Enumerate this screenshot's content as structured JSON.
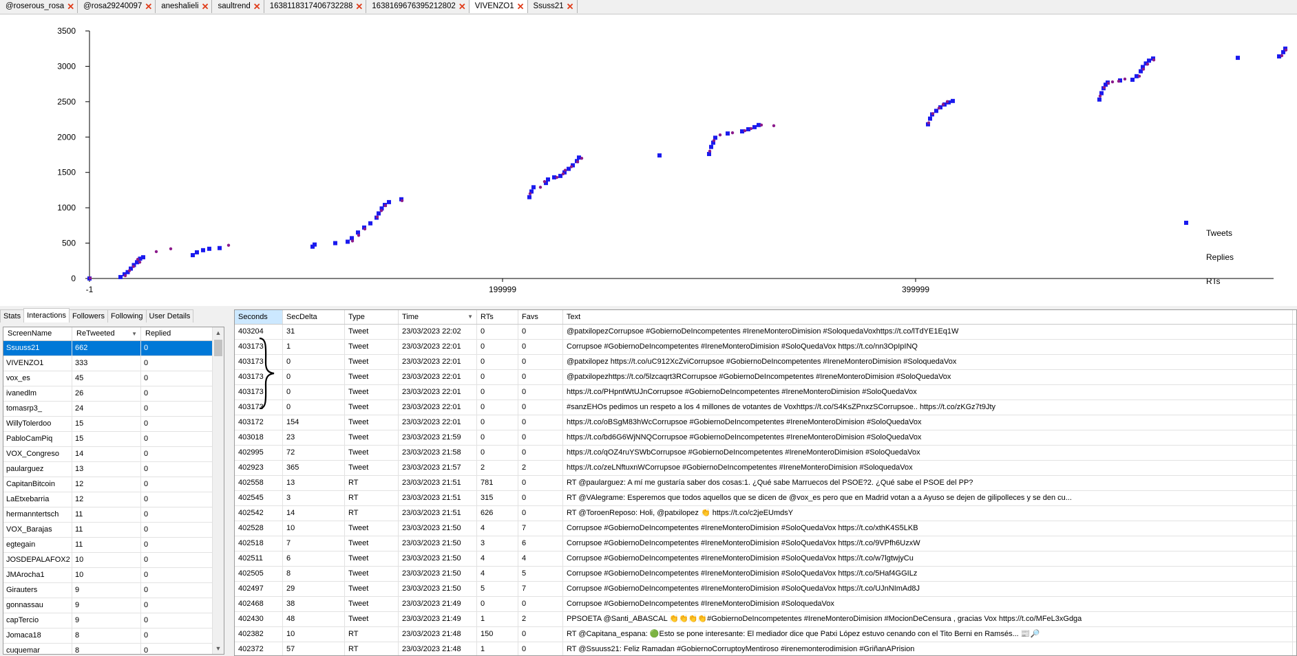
{
  "tabs": [
    {
      "label": "@roserous_rosa",
      "active": false
    },
    {
      "label": "@rosa29240097",
      "active": false
    },
    {
      "label": "aneshalieli",
      "active": false
    },
    {
      "label": "saultrend",
      "active": false
    },
    {
      "label": "1638118317406732288",
      "active": false
    },
    {
      "label": "1638169676395212802",
      "active": false
    },
    {
      "label": "VIVENZO1",
      "active": true
    },
    {
      "label": "Ssuss21",
      "active": false
    }
  ],
  "tab_close_icon": "close-x-icon",
  "colors": {
    "tweets": "#8b1a8b",
    "replies": "#e01010",
    "rts": "#1a1aee",
    "selection": "#0078d7",
    "tab_close": "#e03c1a"
  },
  "chart_data": {
    "type": "scatter",
    "x_ticks": [
      "-1",
      "199999",
      "399999"
    ],
    "y_ticks": [
      "0",
      "500",
      "1000",
      "1500",
      "2000",
      "2500",
      "3000",
      "3500"
    ],
    "xlim": [
      -1,
      580000
    ],
    "ylim": [
      0,
      3500
    ],
    "legend_position": "right",
    "legend": [
      "Tweets",
      "Replies",
      "RTs"
    ],
    "series": [
      {
        "name": "Tweets",
        "marker": "dot",
        "points": [
          [
            0,
            5
          ],
          [
            17000,
            40
          ],
          [
            19000,
            110
          ],
          [
            21000,
            170
          ],
          [
            24000,
            230
          ],
          [
            23000,
            270
          ],
          [
            32000,
            380
          ],
          [
            39000,
            420
          ],
          [
            67000,
            470
          ],
          [
            127000,
            530
          ],
          [
            130000,
            610
          ],
          [
            133000,
            700
          ],
          [
            139000,
            870
          ],
          [
            141000,
            960
          ],
          [
            143000,
            1030
          ],
          [
            151000,
            1100
          ],
          [
            213000,
            1200
          ],
          [
            218000,
            1290
          ],
          [
            220000,
            1370
          ],
          [
            226000,
            1430
          ],
          [
            229000,
            1480
          ],
          [
            230000,
            1530
          ],
          [
            233000,
            1580
          ],
          [
            236000,
            1650
          ],
          [
            238000,
            1700
          ],
          [
            300000,
            1800
          ],
          [
            302000,
            1950
          ],
          [
            305000,
            2030
          ],
          [
            311000,
            2060
          ],
          [
            317000,
            2090
          ],
          [
            320000,
            2120
          ],
          [
            325000,
            2170
          ],
          [
            331000,
            2160
          ],
          [
            406000,
            2200
          ],
          [
            408000,
            2330
          ],
          [
            411000,
            2410
          ],
          [
            413000,
            2460
          ],
          [
            415000,
            2500
          ],
          [
            489000,
            2580
          ],
          [
            491000,
            2700
          ],
          [
            493000,
            2760
          ],
          [
            495000,
            2780
          ],
          [
            498000,
            2790
          ],
          [
            501000,
            2820
          ],
          [
            508000,
            2860
          ],
          [
            510000,
            2960
          ],
          [
            512000,
            3030
          ],
          [
            515000,
            3090
          ],
          [
            577000,
            3150
          ],
          [
            579000,
            3230
          ]
        ]
      },
      {
        "name": "Replies",
        "marker": "dot",
        "points": []
      },
      {
        "name": "RTs",
        "marker": "square",
        "points": [
          [
            0,
            0
          ],
          [
            15000,
            20
          ],
          [
            17000,
            60
          ],
          [
            18500,
            90
          ],
          [
            20000,
            140
          ],
          [
            21500,
            190
          ],
          [
            23000,
            230
          ],
          [
            24500,
            280
          ],
          [
            26000,
            300
          ],
          [
            50000,
            330
          ],
          [
            52000,
            370
          ],
          [
            55000,
            400
          ],
          [
            58000,
            420
          ],
          [
            63000,
            430
          ],
          [
            108000,
            450
          ],
          [
            109000,
            480
          ],
          [
            119000,
            500
          ],
          [
            125000,
            520
          ],
          [
            127000,
            570
          ],
          [
            130000,
            650
          ],
          [
            133000,
            720
          ],
          [
            136000,
            780
          ],
          [
            139000,
            860
          ],
          [
            140000,
            920
          ],
          [
            141500,
            990
          ],
          [
            143000,
            1040
          ],
          [
            145000,
            1080
          ],
          [
            151000,
            1120
          ],
          [
            213000,
            1150
          ],
          [
            214000,
            1230
          ],
          [
            215000,
            1290
          ],
          [
            221000,
            1350
          ],
          [
            222000,
            1400
          ],
          [
            225000,
            1430
          ],
          [
            228000,
            1450
          ],
          [
            230000,
            1500
          ],
          [
            232000,
            1550
          ],
          [
            234000,
            1600
          ],
          [
            236000,
            1660
          ],
          [
            237000,
            1710
          ],
          [
            276000,
            1740
          ],
          [
            300000,
            1760
          ],
          [
            301000,
            1860
          ],
          [
            302000,
            1920
          ],
          [
            303000,
            1990
          ],
          [
            309000,
            2050
          ],
          [
            316000,
            2080
          ],
          [
            319000,
            2110
          ],
          [
            322000,
            2140
          ],
          [
            324000,
            2170
          ],
          [
            406000,
            2180
          ],
          [
            407000,
            2260
          ],
          [
            408000,
            2320
          ],
          [
            410000,
            2370
          ],
          [
            412000,
            2420
          ],
          [
            414000,
            2460
          ],
          [
            416000,
            2490
          ],
          [
            418000,
            2510
          ],
          [
            489000,
            2530
          ],
          [
            490000,
            2620
          ],
          [
            491000,
            2690
          ],
          [
            492000,
            2740
          ],
          [
            493000,
            2770
          ],
          [
            499000,
            2800
          ],
          [
            505000,
            2810
          ],
          [
            507000,
            2860
          ],
          [
            509000,
            2930
          ],
          [
            510000,
            2990
          ],
          [
            511500,
            3040
          ],
          [
            513000,
            3080
          ],
          [
            515000,
            3110
          ],
          [
            556000,
            3120
          ],
          [
            576000,
            3140
          ],
          [
            578000,
            3200
          ],
          [
            579000,
            3250
          ]
        ]
      }
    ]
  },
  "left_tabs": [
    "Stats",
    "Interactions",
    "Followers",
    "Following",
    "User Details"
  ],
  "left_active_tab": "Interactions",
  "left_grid": {
    "columns": [
      "ScreenName",
      "ReTweeted",
      "Replied"
    ],
    "rows": [
      [
        "Ssuuss21",
        "662",
        "0"
      ],
      [
        "VIVENZO1",
        "333",
        "0"
      ],
      [
        "vox_es",
        "45",
        "0"
      ],
      [
        "ivanedlm",
        "26",
        "0"
      ],
      [
        "tomasrp3_",
        "24",
        "0"
      ],
      [
        "WillyTolerdoo",
        "15",
        "0"
      ],
      [
        "PabloCamPiq",
        "15",
        "0"
      ],
      [
        "VOX_Congreso",
        "14",
        "0"
      ],
      [
        "paularguez",
        "13",
        "0"
      ],
      [
        "CapitanBitcoin",
        "12",
        "0"
      ],
      [
        "LaEtxebarria",
        "12",
        "0"
      ],
      [
        "hermanntertsch",
        "11",
        "0"
      ],
      [
        "VOX_Barajas",
        "11",
        "0"
      ],
      [
        "egtegain",
        "11",
        "0"
      ],
      [
        "JOSDEPALAFOX2",
        "10",
        "0"
      ],
      [
        "JMArocha1",
        "10",
        "0"
      ],
      [
        "Girauters",
        "9",
        "0"
      ],
      [
        "gonnassau",
        "9",
        "0"
      ],
      [
        "capTercio",
        "9",
        "0"
      ],
      [
        "Jomaca18",
        "8",
        "0"
      ],
      [
        "cuquemar",
        "8",
        "0"
      ]
    ]
  },
  "right_grid": {
    "columns": [
      "Seconds",
      "SecDelta",
      "Type",
      "Time",
      "RTs",
      "Favs",
      "Text"
    ],
    "rows": [
      [
        "403204",
        "31",
        "Tweet",
        "23/03/2023 22:02",
        "0",
        "0",
        "@patxilopezCorrupsoe #GobiernoDeIncompetentes #IreneMonteroDimision #SoloquedaVoxhttps://t.co/lTdYE1Eq1W"
      ],
      [
        "403173",
        "1",
        "Tweet",
        "23/03/2023 22:01",
        "0",
        "0",
        "Corrupsoe #GobiernoDeIncompetentes #IreneMonteroDimision #SoloQuedaVox https://t.co/nn3OpIpINQ"
      ],
      [
        "403173",
        "0",
        "Tweet",
        "23/03/2023 22:01",
        "0",
        "0",
        "@patxilopez https://t.co/uC912XcZviCorrupsoe #GobiernoDeIncompetentes #IreneMonteroDimision #SoloquedaVox"
      ],
      [
        "403173",
        "0",
        "Tweet",
        "23/03/2023 22:01",
        "0",
        "0",
        "@patxilopezhttps://t.co/5lzcaqrt3RCorrupsoe #GobiernoDeIncompetentes #IreneMonteroDimision #SoloQuedaVox"
      ],
      [
        "403173",
        "0",
        "Tweet",
        "23/03/2023 22:01",
        "0",
        "0",
        "https://t.co/PHpntWtUJnCorrupsoe #GobiernoDeIncompetentes #IreneMonteroDimision #SoloQuedaVox"
      ],
      [
        "403173",
        "0",
        "Tweet",
        "23/03/2023 22:01",
        "0",
        "0",
        "#sanzEHOs pedimos un respeto a los 4 millones de votantes de Voxhttps://t.co/S4KsZPnxzSCorrupsoe.. https://t.co/zKGz7t9Jty"
      ],
      [
        "403172",
        "154",
        "Tweet",
        "23/03/2023 22:01",
        "0",
        "0",
        "https://t.co/oBSgM83hWcCorrupsoe #GobiernoDeIncompetentes #IreneMonteroDimision #SoloQuedaVox"
      ],
      [
        "403018",
        "23",
        "Tweet",
        "23/03/2023 21:59",
        "0",
        "0",
        "https://t.co/bd6G6WjNNQCorrupsoe #GobiernoDeIncompetentes #IreneMonteroDimision #SoloQuedaVox"
      ],
      [
        "402995",
        "72",
        "Tweet",
        "23/03/2023 21:58",
        "0",
        "0",
        "https://t.co/qOZ4ruYSWbCorrupsoe #GobiernoDeIncompetentes #IreneMonteroDimision #SoloQuedaVox"
      ],
      [
        "402923",
        "365",
        "Tweet",
        "23/03/2023 21:57",
        "2",
        "2",
        "https://t.co/zeLNftuxnWCorrupsoe #GobiernoDeIncompetentes #IreneMonteroDimision #SoloquedaVox"
      ],
      [
        "402558",
        "13",
        "RT",
        "23/03/2023 21:51",
        "781",
        "0",
        "RT @paularguez: A mí me gustaría saber dos cosas:1. ¿Qué sabe Marruecos del PSOE?2. ¿Qué sabe el PSOE del PP?"
      ],
      [
        "402545",
        "3",
        "RT",
        "23/03/2023 21:51",
        "315",
        "0",
        "RT @VAlegrame: Esperemos que todos aquellos que se dicen de @vox_es pero que en Madrid votan a a Ayuso se dejen de gilipolleces y se den cu..."
      ],
      [
        "402542",
        "14",
        "RT",
        "23/03/2023 21:51",
        "626",
        "0",
        "RT @ToroenReposo: Holi, @patxilopez 👏 https://t.co/c2jeEUmdsY"
      ],
      [
        "402528",
        "10",
        "Tweet",
        "23/03/2023 21:50",
        "4",
        "7",
        "Corrupsoe #GobiernoDeIncompetentes #IreneMonteroDimision #SoloQuedaVox https://t.co/xthK4S5LKB"
      ],
      [
        "402518",
        "7",
        "Tweet",
        "23/03/2023 21:50",
        "3",
        "6",
        "Corrupsoe #GobiernoDeIncompetentes #IreneMonteroDimision #SoloQuedaVox https://t.co/9VPfh6UzxW"
      ],
      [
        "402511",
        "6",
        "Tweet",
        "23/03/2023 21:50",
        "4",
        "4",
        "Corrupsoe #GobiernoDeIncompetentes #IreneMonteroDimision #SoloQuedaVox https://t.co/w7lgtwjyCu"
      ],
      [
        "402505",
        "8",
        "Tweet",
        "23/03/2023 21:50",
        "4",
        "5",
        "Corrupsoe #GobiernoDeIncompetentes #IreneMonteroDimision #SoloQuedaVox https://t.co/5Haf4GGILz"
      ],
      [
        "402497",
        "29",
        "Tweet",
        "23/03/2023 21:50",
        "5",
        "7",
        "Corrupsoe #GobiernoDeIncompetentes #IreneMonteroDimision #SoloQuedaVox https://t.co/UJnNImAd8J"
      ],
      [
        "402468",
        "38",
        "Tweet",
        "23/03/2023 21:49",
        "0",
        "0",
        "Corrupsoe #GobiernoDeIncompetentes #IreneMonteroDimision #SoloquedaVox"
      ],
      [
        "402430",
        "48",
        "Tweet",
        "23/03/2023 21:49",
        "1",
        "2",
        "PPSOETA @Santi_ABASCAL 👏👏👏👏#GobiernoDeIncompetentes #IreneMonteroDimision #MocionDeCensura , gracias Vox https://t.co/MFeL3xGdga"
      ],
      [
        "402382",
        "10",
        "RT",
        "23/03/2023 21:48",
        "150",
        "0",
        "RT @Capitana_espana: 🟢Esto se pone interesante: El mediador dice que Patxi López estuvo cenando con el Tito Berni en Ramsés... 📰🔎"
      ],
      [
        "402372",
        "57",
        "RT",
        "23/03/2023 21:48",
        "1",
        "0",
        "RT @Ssuuss21: Feliz Ramadan #GobiernoCorruptoyMentiroso #irenemonterodimision #GriñanAPrision"
      ]
    ]
  }
}
